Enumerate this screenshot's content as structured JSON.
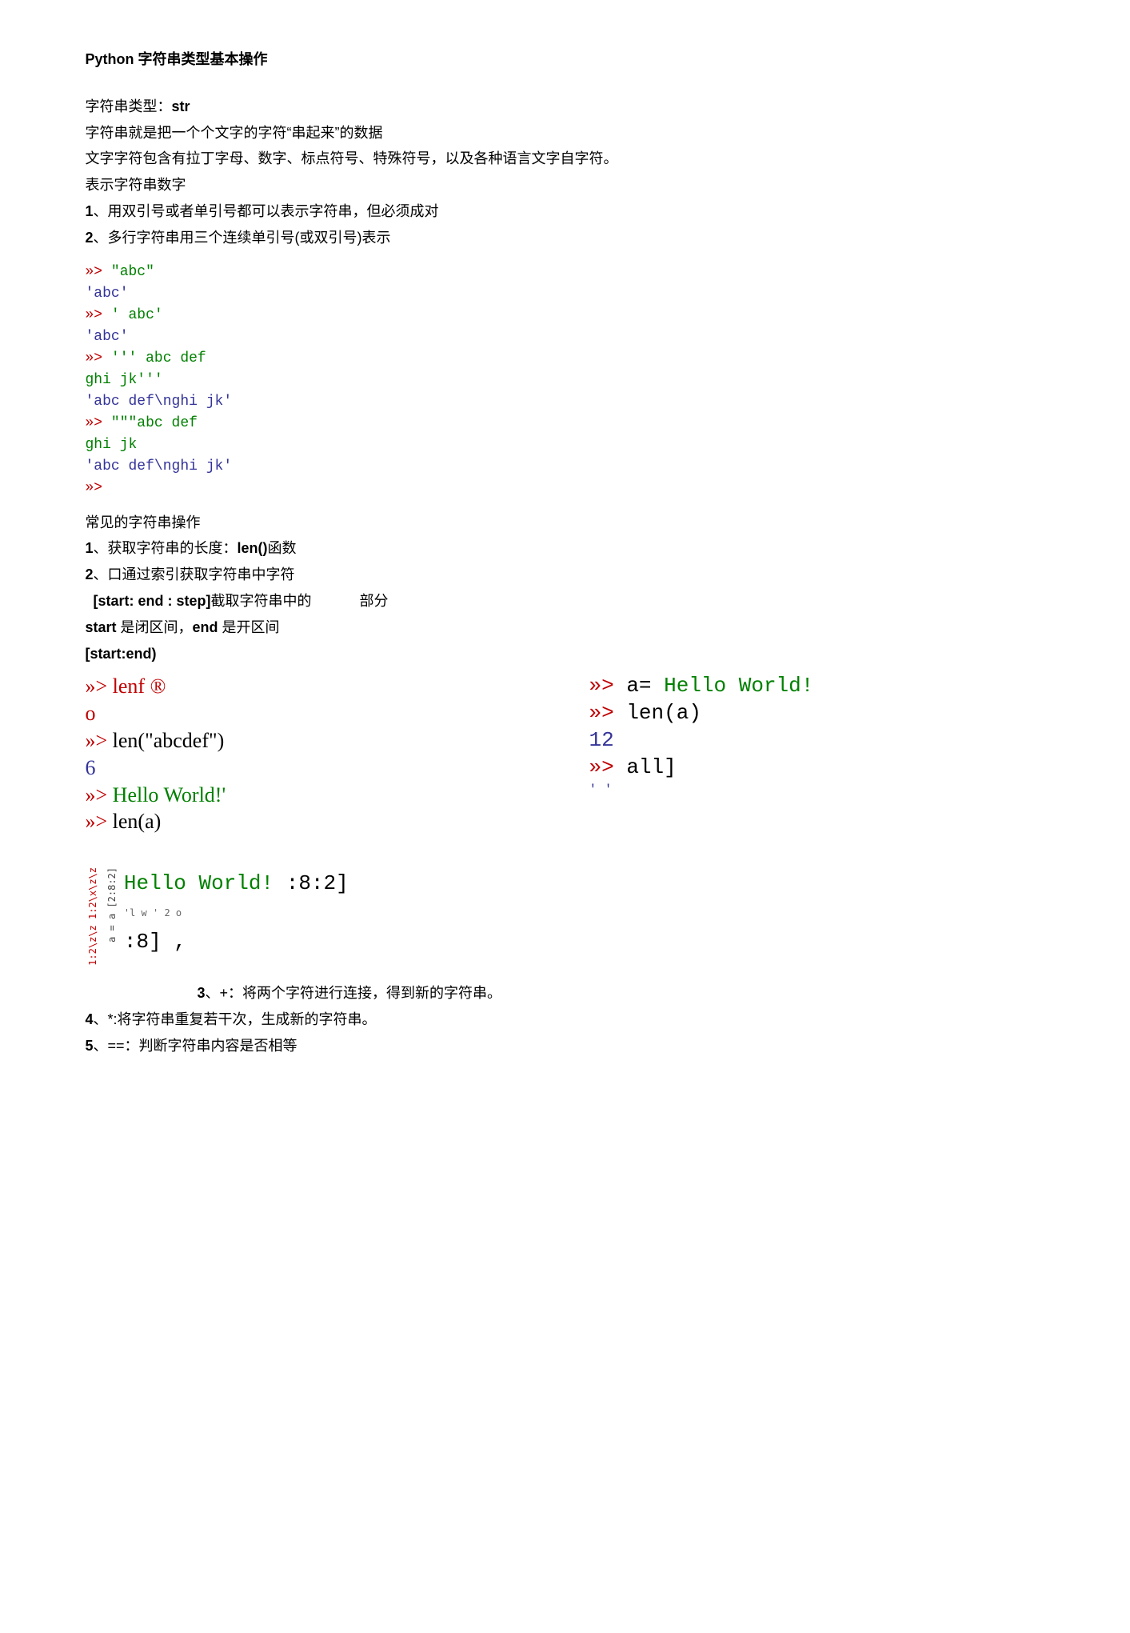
{
  "title": "Python 字符串类型基本操作",
  "intro": {
    "line1_prefix": "字符串类型：",
    "line1_bold": "str",
    "line2": "字符串就是把一个个文字的字符“串起来”的数据",
    "line3": "文字字符包含有拉丁字母、数字、标点符号、特殊符号，以及各种语言文字自字符。",
    "line4": "表示字符串数字",
    "rule1_num": "1",
    "rule1_text": "、用双引号或者单引号都可以表示字符串，但必须成对",
    "rule2_num": "2",
    "rule2_text": "、多行字符串用三个连续单引号(或双引号)表示"
  },
  "code1": {
    "l1_prompt": "»> ",
    "l1_str": "\"abc\"",
    "l2": "'abc'",
    "l3_prompt": "»> ",
    "l3_str": "' abc'",
    "l4": "'abc'",
    "l5_prompt": "»> ",
    "l5_str": "''' abc def",
    "l6_str": "ghi jk'''",
    "l7": "'abc def\\nghi jk'",
    "l8_prompt": "»> ",
    "l8_str": "\"\"\"abc def",
    "l9_str": "ghi jk",
    "l10": "'abc def\\nghi jk'",
    "l11_prompt": "»>"
  },
  "ops": {
    "heading": "常见的字符串操作",
    "item1_num": "1",
    "item1_text": "、获取字符串的长度：",
    "item1_bold": "len()",
    "item1_suffix": "函数",
    "item2_num": "2",
    "item2_text": "、口通过索引获取字符串中字符",
    "slice_bold": "[start: end : step]",
    "slice_text1": "截取字符串中的",
    "slice_text2": "部分",
    "range_prefix": "start",
    "range_mid": " 是闭区间，",
    "range_bold2": "end",
    "range_suffix": " 是开区间",
    "range_final": "[start:end)"
  },
  "left_col": {
    "l1": "»> lenf ®",
    "l2": "o",
    "l3_prompt": "»> ",
    "l3_rest": "len(\"abcdef\")",
    "l4": "6",
    "l5_prompt": "»> ",
    "l5_rest": "Hello World!'",
    "l6_prompt": "»> ",
    "l6_rest": "len(a)"
  },
  "right_col": {
    "l1_prompt": "»> ",
    "l1_mid": "a= ",
    "l1_rest": "Hello World!",
    "l2_prompt": "»> ",
    "l2_rest": "len(a)",
    "l3": "12",
    "l4_prompt": "»> ",
    "l4_rest": "all]",
    "l5": "' '"
  },
  "section3": {
    "rotated": "1:2\\z\\z 1:2\\x\\z\\z",
    "stack1": "a = a [2:8:2]",
    "stack2": "'l w ' 2 o",
    "line1_green": "Hello World!",
    "line1_rest": " :8:2]",
    "line2": ":8] ,",
    "item3_num": "3",
    "item3_text": "、+：将两个字符进行连接，得到新的字符串。",
    "item4_num": "4",
    "item4_text": "、*:将字符串重复若干次，生成新的字符串。",
    "item5_num": "5",
    "item5_text": "、==：判断字符串内容是否相等"
  }
}
